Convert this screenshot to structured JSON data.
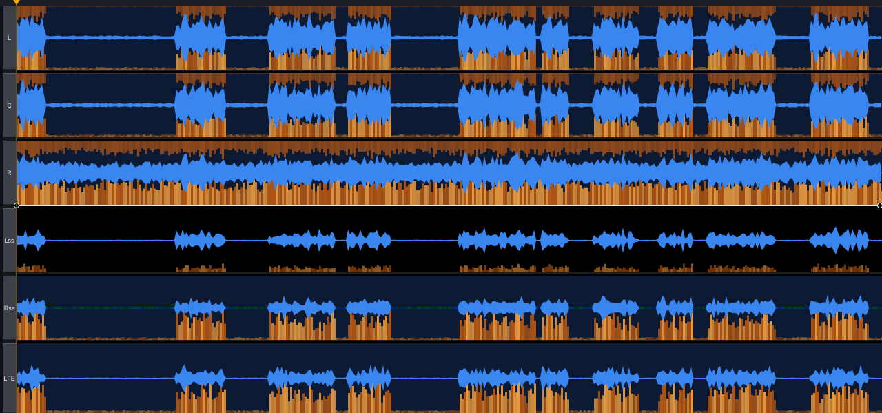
{
  "channels": [
    {
      "id": "L",
      "label": "L"
    },
    {
      "id": "C",
      "label": "C"
    },
    {
      "id": "R",
      "label": "R"
    },
    {
      "id": "Lss",
      "label": "Lss"
    },
    {
      "id": "Rss",
      "label": "Rss"
    },
    {
      "id": "LFE",
      "label": "LFE"
    }
  ],
  "colors": {
    "waveform": "#3a86f0",
    "spectrogram_bg": "#0c1a34",
    "spectrogram_hot": "#f2a040",
    "spectrogram_warm": "#c25c12",
    "playhead": "#f0a41e"
  }
}
